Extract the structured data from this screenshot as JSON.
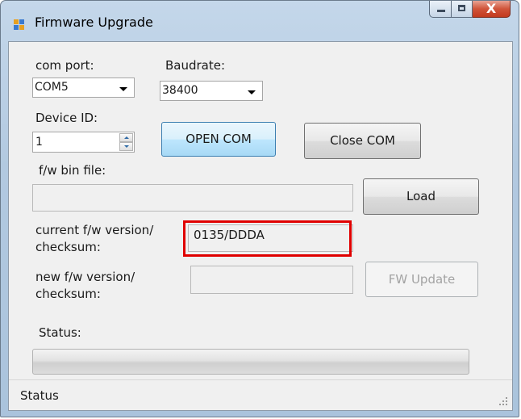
{
  "window": {
    "title": "Firmware Upgrade",
    "close_glyph": "X"
  },
  "labels": {
    "com_port": "com port:",
    "baudrate": "Baudrate:",
    "device_id": "Device ID:",
    "fw_bin_file": "f/w bin file:",
    "current_fw_line1": "current f/w version/",
    "current_fw_line2": "checksum:",
    "new_fw_line1": "new f/w version/",
    "new_fw_line2": "checksum:",
    "status": "Status:"
  },
  "fields": {
    "com_port_value": "COM5",
    "baudrate_value": "38400",
    "device_id_value": "1",
    "fw_bin_file_value": "",
    "current_fw_value": "0135/DDDA",
    "new_fw_value": ""
  },
  "buttons": {
    "open_com": "OPEN COM",
    "close_com": "Close COM",
    "load": "Load",
    "fw_update": "FW Update"
  },
  "progress": {
    "value": 0
  },
  "statusbar": {
    "text": "Status"
  },
  "colors": {
    "highlight": "#e00000",
    "focus_button": "#bee6fd"
  },
  "icons": [
    "app-icon",
    "minimize-icon",
    "maximize-icon",
    "close-icon",
    "spin-up-icon",
    "spin-down-icon",
    "dropdown-arrow-icon",
    "size-grip-icon"
  ]
}
